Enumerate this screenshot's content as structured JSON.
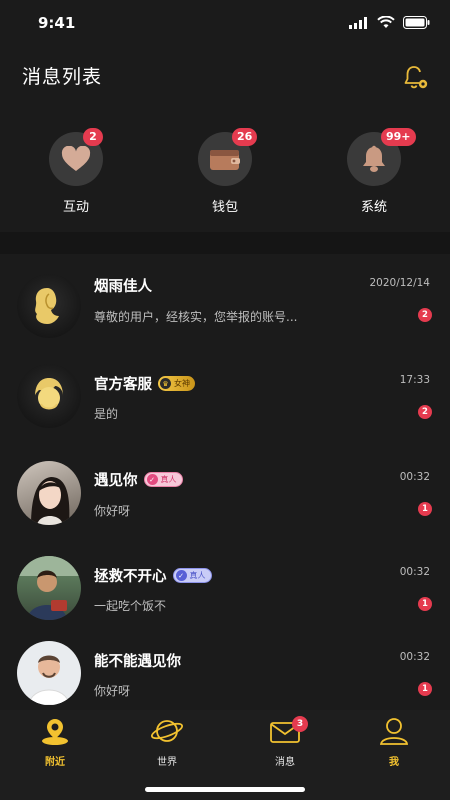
{
  "status_bar": {
    "time": "9:41"
  },
  "header": {
    "title": "消息列表"
  },
  "categories": [
    {
      "label": "互动",
      "badge": "2",
      "icon": "heart-icon"
    },
    {
      "label": "钱包",
      "badge": "26",
      "icon": "wallet-icon"
    },
    {
      "label": "系统",
      "badge": "99+",
      "icon": "bell-icon"
    }
  ],
  "messages": [
    {
      "name": "烟雨佳人",
      "preview": "尊敬的用户，经核实，您举报的账号...",
      "time": "2020/12/14",
      "unread": "2",
      "tag": ""
    },
    {
      "name": "官方客服",
      "preview": "是的",
      "time": "17:33",
      "unread": "2",
      "tag": "女神"
    },
    {
      "name": "遇见你",
      "preview": "你好呀",
      "time": "00:32",
      "unread": "1",
      "tag": "真人"
    },
    {
      "name": "拯救不开心",
      "preview": "一起吃个饭不",
      "time": "00:32",
      "unread": "1",
      "tag": "真人"
    },
    {
      "name": "能不能遇见你",
      "preview": "你好呀",
      "time": "00:32",
      "unread": "1",
      "tag": ""
    }
  ],
  "bottom_nav": [
    {
      "label": "附近",
      "icon": "nearby-pin-icon",
      "active": true
    },
    {
      "label": "世界",
      "icon": "planet-icon"
    },
    {
      "label": "消息",
      "icon": "mail-icon",
      "badge": "3"
    },
    {
      "label": "我",
      "icon": "profile-icon"
    }
  ],
  "colors": {
    "accent": "#f2c230",
    "badge": "#e53b4f",
    "background": "#1b1b1b"
  }
}
